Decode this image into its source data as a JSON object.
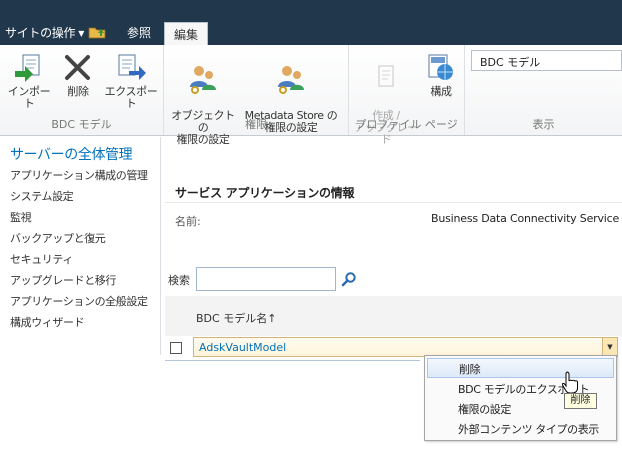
{
  "topbar": {
    "site_actions": "サイトの操作",
    "tabs": [
      "参照",
      "編集"
    ]
  },
  "ribbon": {
    "groups": [
      {
        "label": "BDC モデル",
        "buttons": [
          "インポート",
          "削除",
          "エクスポート"
        ]
      },
      {
        "label": "権限",
        "buttons": [
          "オブジェクトの\n権限の設定",
          "Metadata Store の\n権限の設定"
        ]
      },
      {
        "label": "プロファイル ページ",
        "buttons": [
          "作成 /\nアップグレード",
          "構成"
        ]
      },
      {
        "label": "表示"
      }
    ],
    "view_select": "BDC モデル"
  },
  "leftnav": {
    "head": "サーバーの全体管理",
    "items": [
      "アプリケーション構成の管理",
      "システム設定",
      "監視",
      "バックアップと復元",
      "セキュリティ",
      "アップグレードと移行",
      "アプリケーションの全般設定",
      "構成ウィザード"
    ]
  },
  "main": {
    "section_title": "サービス アプリケーションの情報",
    "name_label": "名前:",
    "name_value": "Business Data Connectivity Service",
    "search_label": "検索",
    "column_header": "BDC モデル名↑",
    "row_value": "AdskVaultModel"
  },
  "context_menu": {
    "items": [
      "削除",
      "BDC モデルのエクスポート",
      "権限の設定",
      "外部コンテンツ タイプの表示"
    ],
    "highlighted": 0
  },
  "tooltip": "削除",
  "colors": {
    "topbar": "#21374c",
    "link": "#0072bc",
    "row_highlight": "#fff4d9"
  }
}
